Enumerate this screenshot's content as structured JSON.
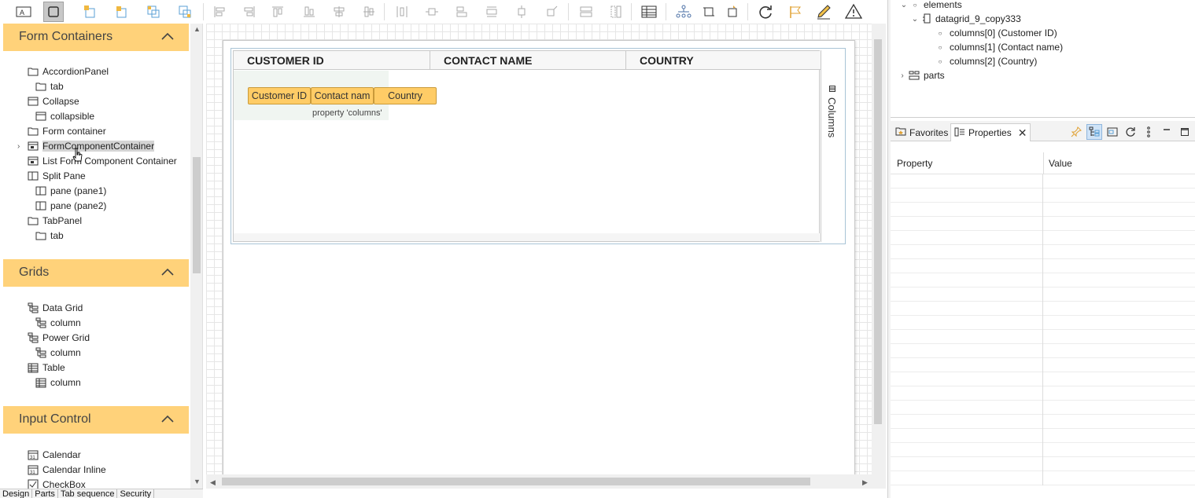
{
  "toolbar": {
    "tools": [
      "label-tool-icon",
      "select-tool-icon",
      "bring-forward-icon",
      "send-backward-icon",
      "bring-to-front-icon",
      "send-to-back-icon",
      "align-left-icon",
      "align-right-icon",
      "align-top-icon",
      "align-bottom-icon",
      "align-center-icon",
      "align-middle-icon",
      "distribute-h-icon",
      "distribute-v-icon",
      "same-width-icon",
      "same-height-icon",
      "same-size-icon",
      "group-icon",
      "anchor-icon",
      "column-layout-icon",
      "table-icon",
      "hierarchy-icon",
      "frame-icon",
      "crop-icon",
      "refresh-icon",
      "flag-icon",
      "edit-pencil-icon",
      "warning-icon"
    ]
  },
  "palette": {
    "categories": [
      {
        "title": "Form Containers",
        "items": [
          {
            "label": "AccordionPanel",
            "icon": "folder-icon",
            "indent": 0
          },
          {
            "label": "tab",
            "icon": "folder-icon",
            "indent": 1
          },
          {
            "label": "Collapse",
            "icon": "collapse-icon",
            "indent": 0
          },
          {
            "label": "collapsible",
            "icon": "collapse-icon",
            "indent": 1
          },
          {
            "label": "Form container",
            "icon": "folder-icon",
            "indent": 0
          },
          {
            "label": "FormComponentContainer",
            "icon": "form-component-icon",
            "indent": 0,
            "expandable": true,
            "selected": true
          },
          {
            "label": "List Form Component Container",
            "icon": "form-component-icon",
            "indent": 0
          },
          {
            "label": "Split Pane",
            "icon": "split-pane-icon",
            "indent": 0
          },
          {
            "label": "pane (pane1)",
            "icon": "split-pane-icon",
            "indent": 1
          },
          {
            "label": "pane (pane2)",
            "icon": "split-pane-icon",
            "indent": 1
          },
          {
            "label": "TabPanel",
            "icon": "folder-icon",
            "indent": 0
          },
          {
            "label": "tab",
            "icon": "folder-icon",
            "indent": 1
          }
        ]
      },
      {
        "title": "Grids",
        "items": [
          {
            "label": "Data Grid",
            "icon": "data-grid-icon",
            "indent": 0
          },
          {
            "label": "column",
            "icon": "data-grid-icon",
            "indent": 1
          },
          {
            "label": "Power Grid",
            "icon": "data-grid-icon",
            "indent": 0
          },
          {
            "label": "column",
            "icon": "data-grid-icon",
            "indent": 1
          },
          {
            "label": "Table",
            "icon": "table-icon",
            "indent": 0
          },
          {
            "label": "column",
            "icon": "table-icon",
            "indent": 1
          }
        ]
      },
      {
        "title": "Input Control",
        "items": [
          {
            "label": "Calendar",
            "icon": "calendar-icon",
            "indent": 0
          },
          {
            "label": "Calendar Inline",
            "icon": "calendar-icon",
            "indent": 0
          },
          {
            "label": "CheckBox",
            "icon": "checkbox-icon",
            "indent": 0
          }
        ]
      }
    ]
  },
  "bottom_tabs": [
    "Design",
    "Parts",
    "Tab sequence",
    "Security"
  ],
  "datagrid": {
    "headers": [
      "CUSTOMER ID",
      "CONTACT NAME",
      "COUNTRY"
    ],
    "columns": [
      "Customer ID",
      "Contact nam",
      "Country"
    ],
    "property_label": "property 'columns'",
    "side_tab": "Columns"
  },
  "outline": {
    "rows": [
      {
        "label": "elements",
        "level": 0,
        "twisty": "expanded",
        "bullet": true
      },
      {
        "label": "datagrid_9_copy333",
        "level": 1,
        "twisty": "expanded",
        "icon": "datagrid-node-icon"
      },
      {
        "label": "columns[0] (Customer ID)",
        "level": 2,
        "bullet": true
      },
      {
        "label": "columns[1] (Contact name)",
        "level": 2,
        "bullet": true
      },
      {
        "label": "columns[2] (Country)",
        "level": 2,
        "bullet": true
      },
      {
        "label": "parts",
        "level": 0,
        "twisty": "collapsed",
        "icon": "parts-icon"
      }
    ]
  },
  "properties_panel": {
    "tabs": [
      {
        "label": "Favorites",
        "active": false
      },
      {
        "label": "Properties",
        "active": true
      }
    ],
    "column_headers": [
      "Property",
      "Value"
    ]
  },
  "colors": {
    "category_header": "#ffd27a",
    "column_chip": "#ffcc66",
    "canvas_grid": "#e6e6e6"
  }
}
